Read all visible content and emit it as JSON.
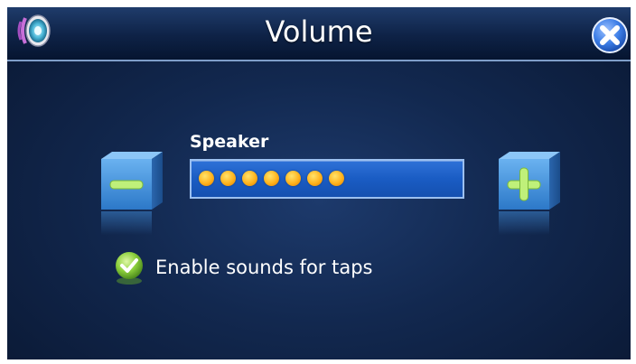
{
  "window": {
    "title": "Volume"
  },
  "volume": {
    "label": "Speaker",
    "level": 7
  },
  "buttons": {
    "decrease_icon": "minus-icon",
    "increase_icon": "plus-icon",
    "close_icon": "close-icon"
  },
  "options": {
    "tap_sounds_label": "Enable sounds for taps",
    "tap_sounds_checked": true
  },
  "colors": {
    "accent_blue": "#1a5cc4",
    "dot_orange": "#ffb21c",
    "check_green": "#8ed13e"
  }
}
